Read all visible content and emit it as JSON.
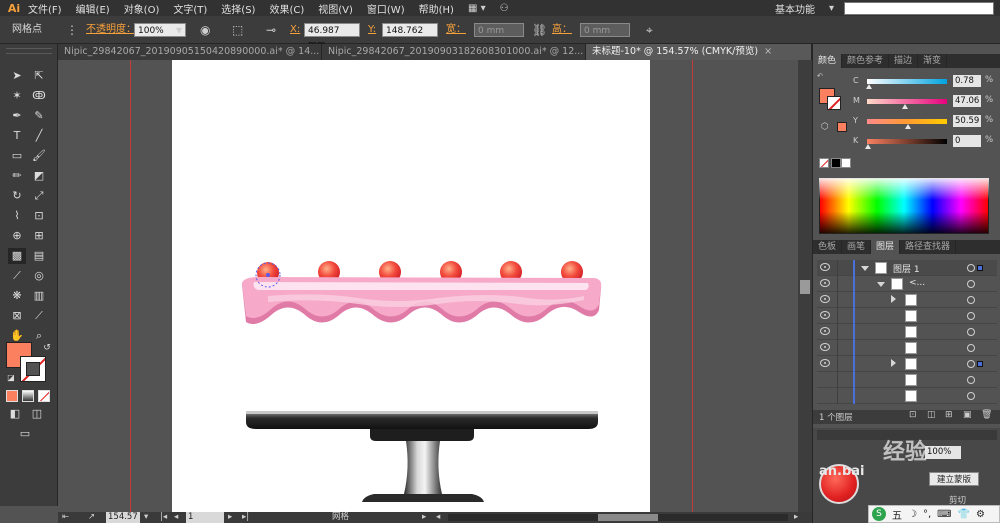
{
  "app": {
    "logo": "Ai",
    "menu": [
      "文件(F)",
      "编辑(E)",
      "对象(O)",
      "文字(T)",
      "选择(S)",
      "效果(C)",
      "视图(V)",
      "窗口(W)",
      "帮助(H)"
    ],
    "workspace": "基本功能"
  },
  "control": {
    "mode_label": "网格点",
    "opacity_label": "不透明度：",
    "opacity_value": "100%",
    "x_label": "X:",
    "x_value": "46.987 mm",
    "y_label": "Y:",
    "y_value": "148.762",
    "w_label": "宽：",
    "w_value": "0 mm",
    "h_label": "高：",
    "h_value": "0 mm"
  },
  "tabs": [
    {
      "label": "Nipic_29842067_20190905150420890000.ai* @ 14...",
      "close": "×"
    },
    {
      "label": "Nipic_29842067_20190903182608301000.ai* @ 12...",
      "close": "×"
    },
    {
      "label": "未标题-10* @ 154.57% (CMYK/预览)",
      "close": "×"
    }
  ],
  "color_panel": {
    "tabs": [
      "颜色",
      "颜色参考",
      "描边",
      "渐变"
    ],
    "fill_color": "#fa8060",
    "channels": [
      {
        "label": "C",
        "value": "0.78",
        "percent": "%",
        "level": 0.01,
        "track": [
          "#ffffff",
          "#00a3e0"
        ]
      },
      {
        "label": "M",
        "value": "47.06",
        "percent": "%",
        "level": 0.47,
        "track": [
          "#ffe0d0",
          "#e6007e"
        ]
      },
      {
        "label": "Y",
        "value": "50.59",
        "percent": "%",
        "level": 0.51,
        "track": [
          "#ff9090",
          "#ffb000"
        ]
      },
      {
        "label": "K",
        "value": "0",
        "percent": "%",
        "level": 0.0,
        "track": [
          "#ffffff",
          "#000000"
        ]
      }
    ]
  },
  "layers_panel": {
    "tabs": [
      "色板",
      "画笔",
      "图层",
      "路径查找器"
    ],
    "layer_name": "图层 1",
    "group_name": "<...",
    "footer_count": "1 个图层"
  },
  "lower_panel": {
    "opacity_value": "100%",
    "button_label": "建立蒙版",
    "text_fragment": "an.bai",
    "release_label": "剪切"
  },
  "status": {
    "zoom": "154.57",
    "page": "1",
    "mode": "网格"
  },
  "ime": [
    "五",
    "☽",
    "°,",
    "⌨",
    "👕",
    "⚙"
  ],
  "watermark": "经验",
  "colors": {
    "cake_pink": "#f6a9c8",
    "cake_light": "#fde3ef",
    "cake_dark": "#e07aa6",
    "berry": "#f03a3a",
    "berry_light": "#ff9a6a",
    "stand_dark": "#1e1e1e"
  }
}
